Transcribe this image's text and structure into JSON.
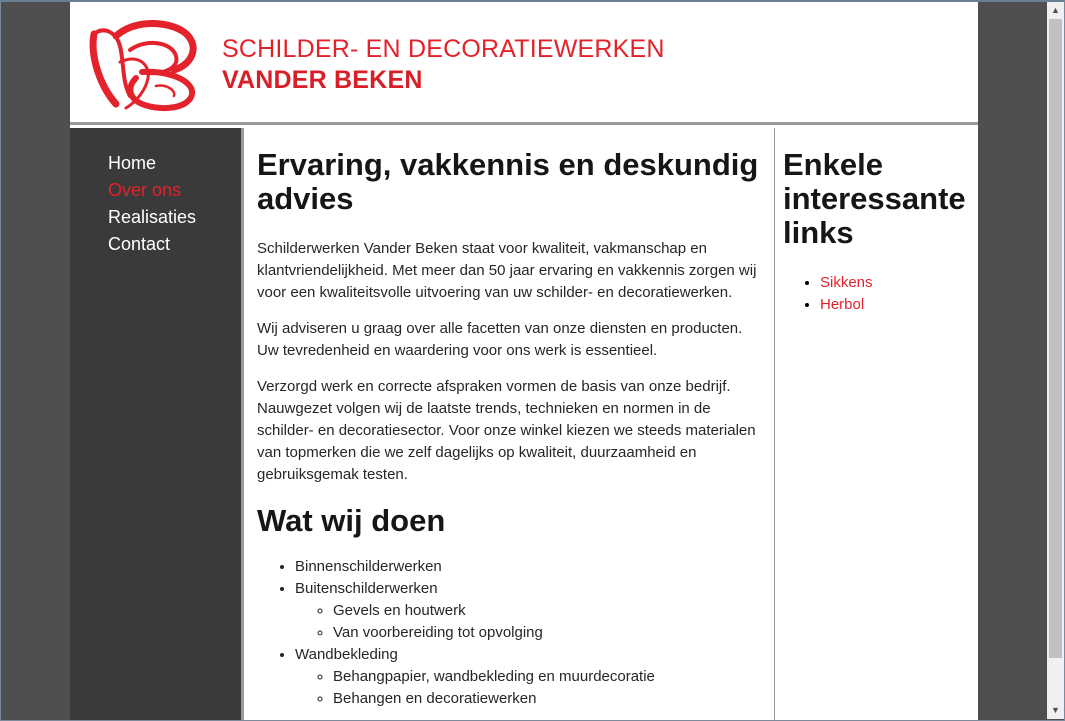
{
  "brand": {
    "line1": "SCHILDER- EN DECORATIEWERKEN",
    "line2": "VANDER BEKEN",
    "accent_color": "#e3222b"
  },
  "nav": {
    "items": [
      {
        "label": "Home",
        "active": false
      },
      {
        "label": "Over ons",
        "active": true
      },
      {
        "label": "Realisaties",
        "active": false
      },
      {
        "label": "Contact",
        "active": false
      }
    ]
  },
  "main": {
    "heading": "Ervaring, vakkennis en deskundig advies",
    "paragraphs": [
      "Schilderwerken Vander Beken staat voor kwaliteit, vakmanschap en klantvriendelijkheid. Met meer dan 50 jaar ervaring en vakkennis zorgen wij voor een kwaliteitsvolle uitvoering van uw schilder- en decoratiewerken.",
      "Wij adviseren u graag over alle facetten van onze diensten en producten. Uw tevredenheid en waardering voor ons werk is essentieel.",
      "Verzorgd werk en correcte afspraken vormen de basis van onze bedrijf. Nauwgezet volgen wij de laatste trends, technieken en normen in de schilder- en decoratiesector. Voor onze winkel kiezen we steeds materialen van topmerken die we zelf dagelijks op kwaliteit, duurzaamheid en gebruiksgemak testen."
    ],
    "services_heading": "Wat wij doen",
    "services": [
      {
        "label": "Binnenschilderwerken",
        "sub": []
      },
      {
        "label": "Buitenschilderwerken",
        "sub": [
          "Gevels en houtwerk",
          "Van voorbereiding tot opvolging"
        ]
      },
      {
        "label": "Wandbekleding",
        "sub": [
          "Behangpapier, wandbekleding en muurdecoratie",
          "Behangen en decoratiewerken"
        ]
      }
    ]
  },
  "aside": {
    "heading": "Enkele interessante links",
    "links": [
      "Sikkens",
      "Herbol"
    ]
  },
  "scrollbar": {
    "up_icon": "▲",
    "down_icon": "▼"
  }
}
